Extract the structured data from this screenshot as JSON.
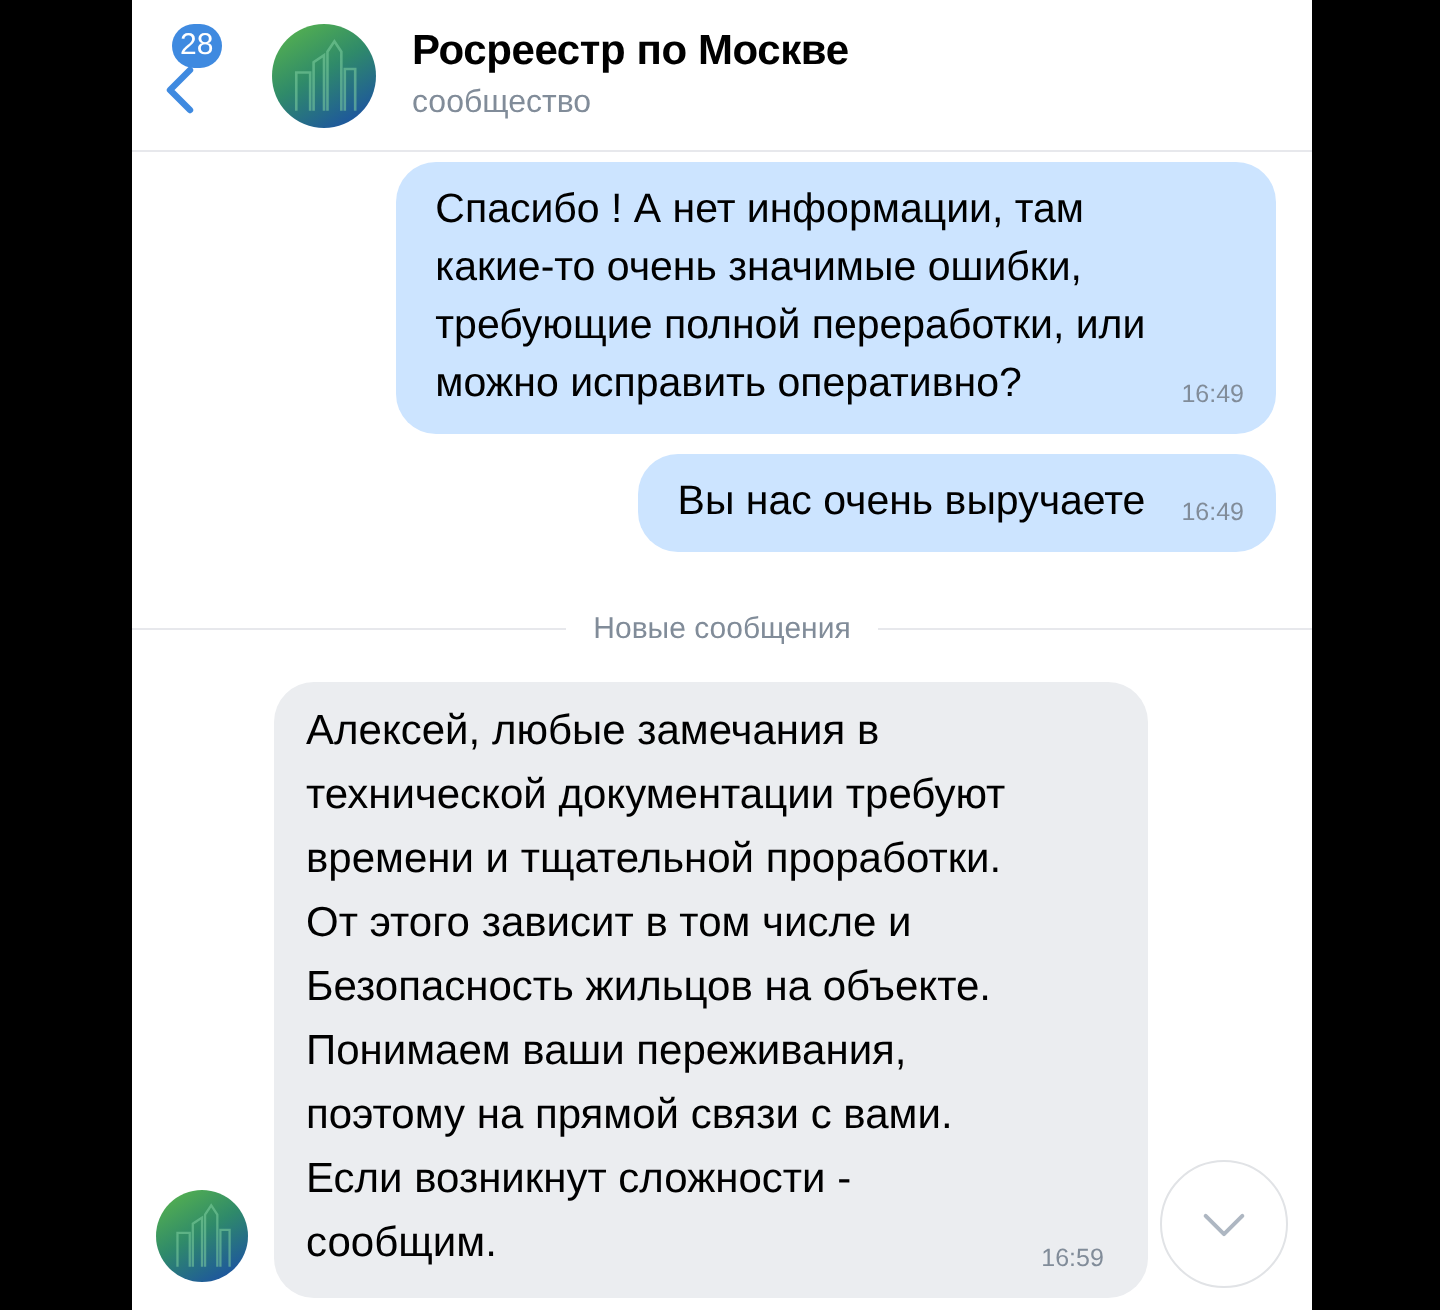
{
  "header": {
    "unread_count": "28",
    "title": "Росреестр по Москве",
    "subtitle": "сообщество"
  },
  "messages": [
    {
      "kind": "outgoing",
      "text": "Спасибо ! А нет информации, там\nкакие-то очень значимые ошибки,\nтребующие полной переработки, или\nможно исправить оперативно?",
      "time": "16:49"
    },
    {
      "kind": "outgoing",
      "text": "Вы нас очень выручаете",
      "time": "16:49"
    },
    {
      "kind": "divider",
      "text": "Новые сообщения"
    },
    {
      "kind": "incoming",
      "text": "Алексей, любые замечания в\nтехнической документации требуют\nвремени и тщательной проработки.\nОт этого зависит в том числе и\nБезопасность жильцов на объекте.\nПонимаем ваши переживания,\nпоэтому на прямой связи с вами.\nЕсли возникнут сложности -\nсообщим.",
      "time": "16:59"
    }
  ]
}
